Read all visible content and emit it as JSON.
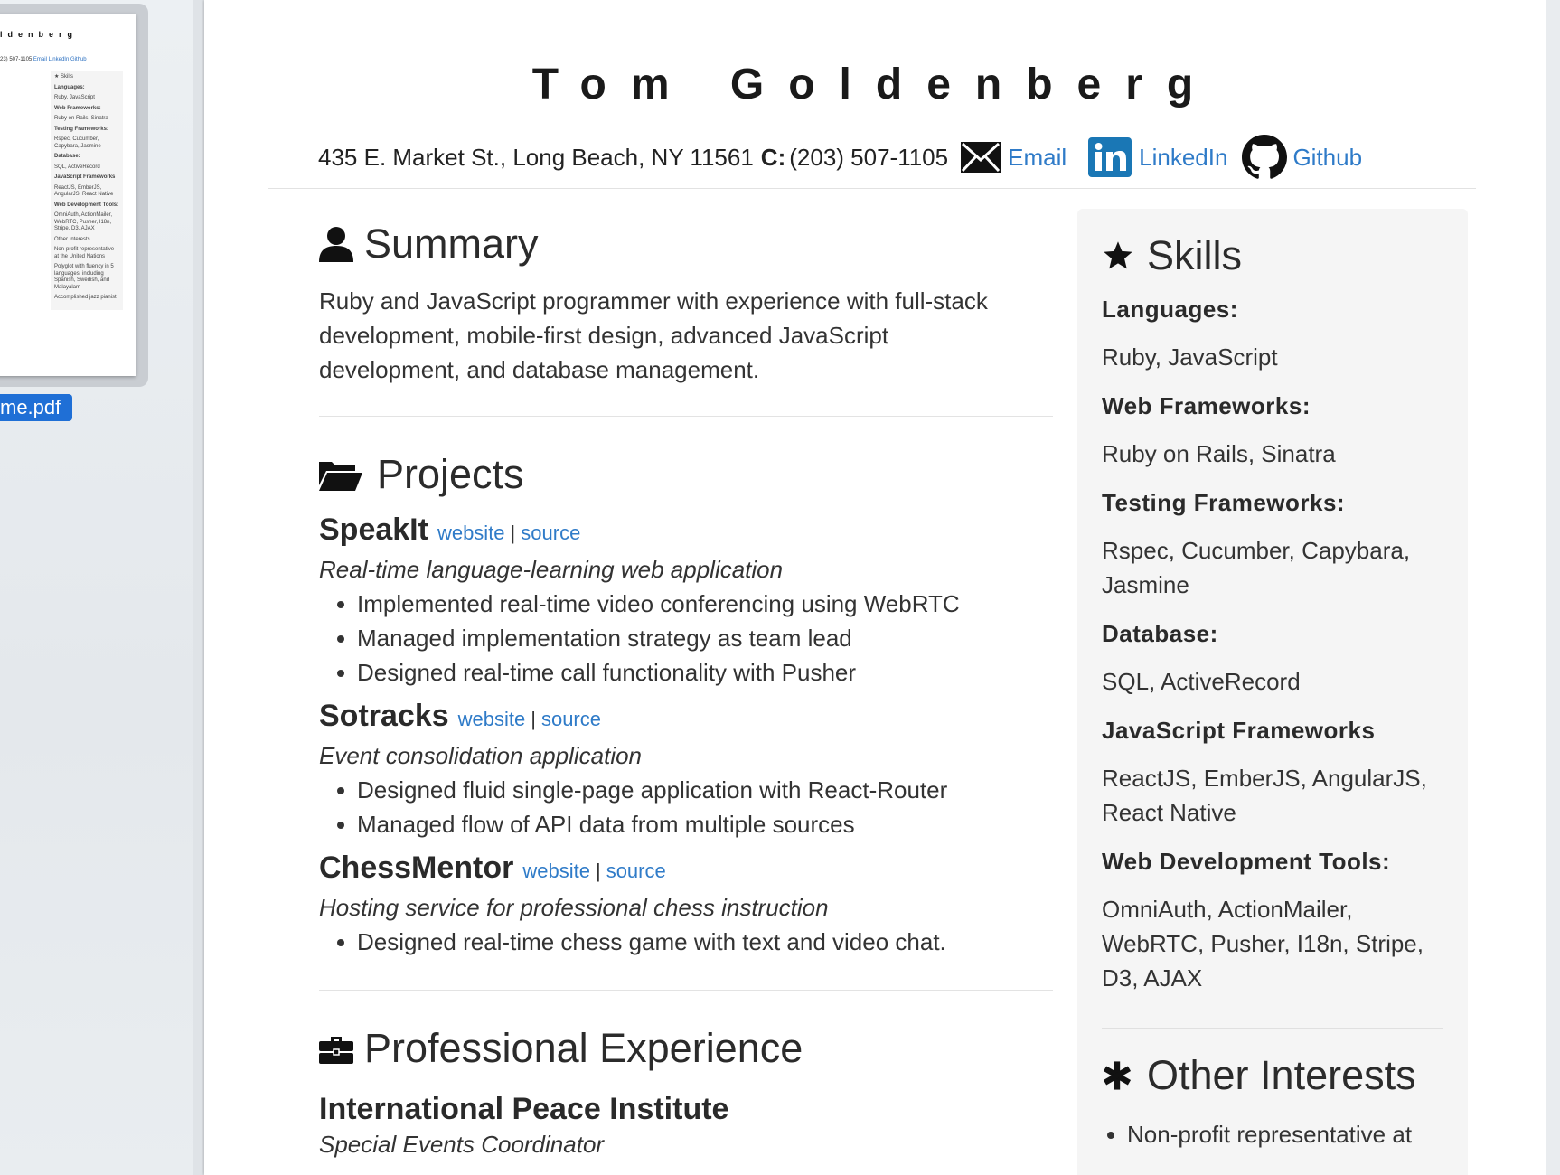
{
  "sidebar": {
    "filename": "me.pdf",
    "thumbnail": {
      "title": "ldenberg",
      "contact": "23) 507-1105",
      "links": [
        "Email",
        "LinkedIn",
        "Github"
      ],
      "skills_heading": "★ Skills",
      "skills_lines": [
        "Languages:",
        "Ruby, JavaScript",
        "Web Frameworks:",
        "Ruby on Rails, Sinatra",
        "Testing Frameworks:",
        "Rspec, Cucumber, Capybara, Jasmine",
        "Database:",
        "SQL, ActiveRecord",
        "JavaScript Frameworks",
        "ReactJS, EmberJS, AngularJS, React Native",
        "Web Development Tools:",
        "OmniAuth, ActionMailer, WebRTC, Pusher, I18n, Stripe, D3, AJAX"
      ],
      "interests_heading": "Other Interests",
      "interests_lines": [
        "Non-profit representative at the United Nations",
        "Polyglot with fluency in 5 languages, including Spanish, Swedish, and Malayalam",
        "Accomplished jazz pianist"
      ]
    }
  },
  "resume": {
    "name": "Tom Goldenberg",
    "address": "435 E. Market St., Long Beach, NY 11561",
    "phone_label": "C:",
    "phone": "(203) 507-1105",
    "email_label": "Email",
    "linkedin_label": "LinkedIn",
    "github_label": "Github",
    "summary": {
      "heading": "Summary",
      "text": "Ruby and JavaScript programmer with experience with full-stack development, mobile-first design, advanced JavaScript development, and database management."
    },
    "projects": {
      "heading": "Projects",
      "items": [
        {
          "name": "SpeakIt",
          "website": "website",
          "source": "source",
          "sep": "|",
          "desc": "Real-time language-learning web application",
          "bullets": [
            "Implemented real-time video conferencing using WebRTC",
            "Managed implementation strategy as team lead",
            "Designed real-time call functionality with Pusher"
          ]
        },
        {
          "name": "Sotracks",
          "website": "website",
          "source": "source",
          "sep": "|",
          "desc": "Event consolidation application",
          "bullets": [
            "Designed fluid single-page application with React-Router",
            "Managed flow of API data from multiple sources"
          ]
        },
        {
          "name": "ChessMentor",
          "website": "website",
          "source": "source",
          "sep": "|",
          "desc": "Hosting service for professional chess instruction",
          "bullets": [
            "Designed real-time chess game with text and video chat."
          ]
        }
      ]
    },
    "experience": {
      "heading": "Professional Experience",
      "job_title": "International Peace Institute",
      "job_role": "Special Events Coordinator"
    },
    "skills": {
      "heading": "Skills",
      "groups": [
        {
          "label": "Languages:",
          "value": "Ruby, JavaScript"
        },
        {
          "label": "Web Frameworks:",
          "value": "Ruby on Rails, Sinatra"
        },
        {
          "label": "Testing Frameworks:",
          "value": "Rspec, Cucumber, Capybara, Jasmine"
        },
        {
          "label": "Database:",
          "value": "SQL, ActiveRecord"
        },
        {
          "label": "JavaScript Frameworks",
          "value": "ReactJS, EmberJS, AngularJS, React Native"
        },
        {
          "label": "Web Development Tools:",
          "value": "OmniAuth, ActionMailer, WebRTC, Pusher, I18n, Stripe, D3, AJAX"
        }
      ]
    },
    "interests": {
      "heading": "Other Interests",
      "first_item": "Non-profit representative at"
    }
  },
  "colors": {
    "link": "#2f7bc8",
    "linkedin_blue": "#1a77b5",
    "selection_blue": "#1f6fd6",
    "aside_bg": "#f5f5f5"
  },
  "icons": {
    "email": "envelope-icon",
    "linkedin": "linkedin-icon",
    "github": "github-icon",
    "summary": "user-icon",
    "projects": "folder-open-icon",
    "experience": "briefcase-icon",
    "skills": "star-icon",
    "interests": "asterisk-icon"
  }
}
